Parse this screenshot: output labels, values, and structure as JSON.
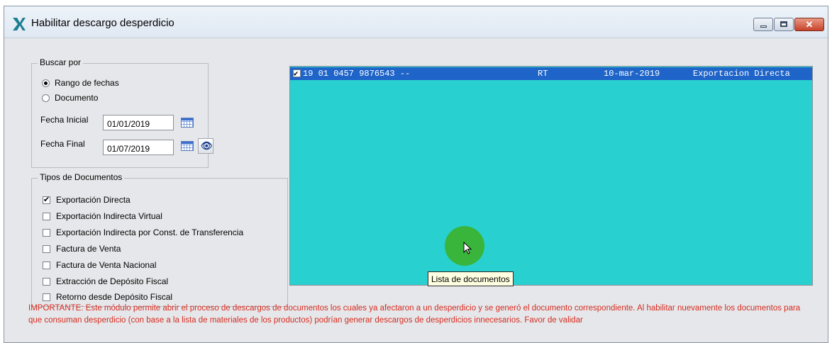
{
  "window": {
    "title": "Habilitar descargo desperdicio",
    "icon": "app-logo-icon"
  },
  "buscar_por": {
    "legend": "Buscar por",
    "option_fechas": "Rango de fechas",
    "option_documento": "Documento",
    "selected": "Rango de fechas",
    "fecha_inicial_label": "Fecha Inicial",
    "fecha_inicial_value": "01/01/2019",
    "fecha_final_label": "Fecha Final",
    "fecha_final_value": "01/07/2019"
  },
  "tipos": {
    "legend": "Tipos de Documentos",
    "items": [
      {
        "label": "Exportación Directa",
        "checked": true
      },
      {
        "label": "Exportación Indirecta Virtual",
        "checked": false
      },
      {
        "label": "Exportación Indirecta por Const. de Transferencia",
        "checked": false
      },
      {
        "label": "Factura de Venta",
        "checked": false
      },
      {
        "label": "Factura de Venta Nacional",
        "checked": false
      },
      {
        "label": "Extracción de Depósito Fiscal",
        "checked": false
      },
      {
        "label": "Retorno desde Depósito Fiscal",
        "checked": false
      }
    ]
  },
  "documents_list": {
    "rows": [
      {
        "checked": true,
        "document": "19 01 0457 9876543 --",
        "code": "RT",
        "date": "10-mar-2019",
        "type": "Exportacion Directa"
      }
    ],
    "tooltip": "Lista de documentos",
    "background": "#29d0d0",
    "selection_color": "#1f64c8"
  },
  "important_note": "IMPORTANTE: Este módulo permite abrir el proceso de descargos de documentos los cuales ya afectaron a un desperdicio y se generó el documento correspondiente. Al habilitar nuevamente los documentos para que consuman desperdicio (con base a la lista de materiales de los productos) podrían generar descargos de desperdicios innecesarios. Favor de validar",
  "colors": {
    "note": "#d62b1f",
    "window_bg": "#e6e7ea"
  }
}
